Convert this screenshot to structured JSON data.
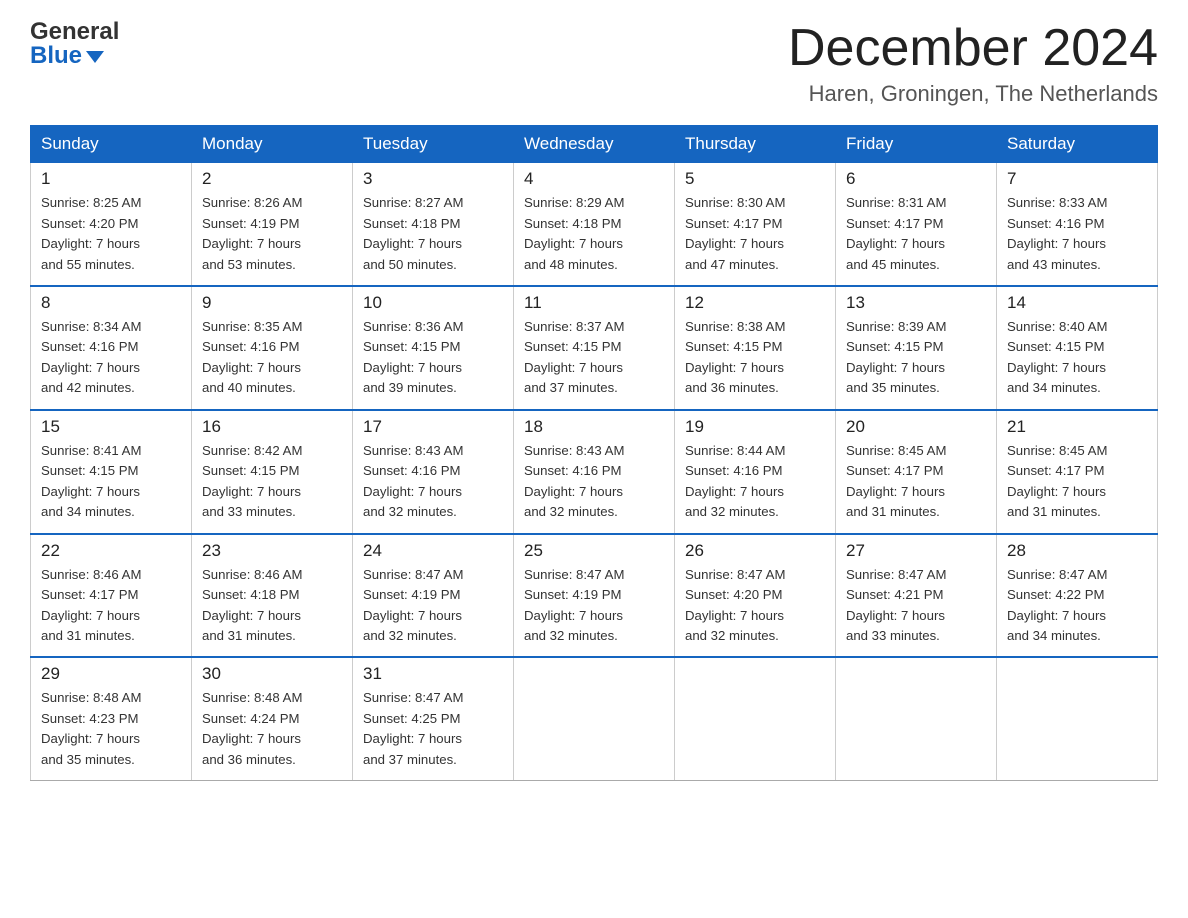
{
  "header": {
    "logo_general": "General",
    "logo_blue": "Blue",
    "main_title": "December 2024",
    "subtitle": "Haren, Groningen, The Netherlands"
  },
  "calendar": {
    "days": [
      "Sunday",
      "Monday",
      "Tuesday",
      "Wednesday",
      "Thursday",
      "Friday",
      "Saturday"
    ],
    "weeks": [
      [
        {
          "num": "1",
          "info": "Sunrise: 8:25 AM\nSunset: 4:20 PM\nDaylight: 7 hours\nand 55 minutes."
        },
        {
          "num": "2",
          "info": "Sunrise: 8:26 AM\nSunset: 4:19 PM\nDaylight: 7 hours\nand 53 minutes."
        },
        {
          "num": "3",
          "info": "Sunrise: 8:27 AM\nSunset: 4:18 PM\nDaylight: 7 hours\nand 50 minutes."
        },
        {
          "num": "4",
          "info": "Sunrise: 8:29 AM\nSunset: 4:18 PM\nDaylight: 7 hours\nand 48 minutes."
        },
        {
          "num": "5",
          "info": "Sunrise: 8:30 AM\nSunset: 4:17 PM\nDaylight: 7 hours\nand 47 minutes."
        },
        {
          "num": "6",
          "info": "Sunrise: 8:31 AM\nSunset: 4:17 PM\nDaylight: 7 hours\nand 45 minutes."
        },
        {
          "num": "7",
          "info": "Sunrise: 8:33 AM\nSunset: 4:16 PM\nDaylight: 7 hours\nand 43 minutes."
        }
      ],
      [
        {
          "num": "8",
          "info": "Sunrise: 8:34 AM\nSunset: 4:16 PM\nDaylight: 7 hours\nand 42 minutes."
        },
        {
          "num": "9",
          "info": "Sunrise: 8:35 AM\nSunset: 4:16 PM\nDaylight: 7 hours\nand 40 minutes."
        },
        {
          "num": "10",
          "info": "Sunrise: 8:36 AM\nSunset: 4:15 PM\nDaylight: 7 hours\nand 39 minutes."
        },
        {
          "num": "11",
          "info": "Sunrise: 8:37 AM\nSunset: 4:15 PM\nDaylight: 7 hours\nand 37 minutes."
        },
        {
          "num": "12",
          "info": "Sunrise: 8:38 AM\nSunset: 4:15 PM\nDaylight: 7 hours\nand 36 minutes."
        },
        {
          "num": "13",
          "info": "Sunrise: 8:39 AM\nSunset: 4:15 PM\nDaylight: 7 hours\nand 35 minutes."
        },
        {
          "num": "14",
          "info": "Sunrise: 8:40 AM\nSunset: 4:15 PM\nDaylight: 7 hours\nand 34 minutes."
        }
      ],
      [
        {
          "num": "15",
          "info": "Sunrise: 8:41 AM\nSunset: 4:15 PM\nDaylight: 7 hours\nand 34 minutes."
        },
        {
          "num": "16",
          "info": "Sunrise: 8:42 AM\nSunset: 4:15 PM\nDaylight: 7 hours\nand 33 minutes."
        },
        {
          "num": "17",
          "info": "Sunrise: 8:43 AM\nSunset: 4:16 PM\nDaylight: 7 hours\nand 32 minutes."
        },
        {
          "num": "18",
          "info": "Sunrise: 8:43 AM\nSunset: 4:16 PM\nDaylight: 7 hours\nand 32 minutes."
        },
        {
          "num": "19",
          "info": "Sunrise: 8:44 AM\nSunset: 4:16 PM\nDaylight: 7 hours\nand 32 minutes."
        },
        {
          "num": "20",
          "info": "Sunrise: 8:45 AM\nSunset: 4:17 PM\nDaylight: 7 hours\nand 31 minutes."
        },
        {
          "num": "21",
          "info": "Sunrise: 8:45 AM\nSunset: 4:17 PM\nDaylight: 7 hours\nand 31 minutes."
        }
      ],
      [
        {
          "num": "22",
          "info": "Sunrise: 8:46 AM\nSunset: 4:17 PM\nDaylight: 7 hours\nand 31 minutes."
        },
        {
          "num": "23",
          "info": "Sunrise: 8:46 AM\nSunset: 4:18 PM\nDaylight: 7 hours\nand 31 minutes."
        },
        {
          "num": "24",
          "info": "Sunrise: 8:47 AM\nSunset: 4:19 PM\nDaylight: 7 hours\nand 32 minutes."
        },
        {
          "num": "25",
          "info": "Sunrise: 8:47 AM\nSunset: 4:19 PM\nDaylight: 7 hours\nand 32 minutes."
        },
        {
          "num": "26",
          "info": "Sunrise: 8:47 AM\nSunset: 4:20 PM\nDaylight: 7 hours\nand 32 minutes."
        },
        {
          "num": "27",
          "info": "Sunrise: 8:47 AM\nSunset: 4:21 PM\nDaylight: 7 hours\nand 33 minutes."
        },
        {
          "num": "28",
          "info": "Sunrise: 8:47 AM\nSunset: 4:22 PM\nDaylight: 7 hours\nand 34 minutes."
        }
      ],
      [
        {
          "num": "29",
          "info": "Sunrise: 8:48 AM\nSunset: 4:23 PM\nDaylight: 7 hours\nand 35 minutes."
        },
        {
          "num": "30",
          "info": "Sunrise: 8:48 AM\nSunset: 4:24 PM\nDaylight: 7 hours\nand 36 minutes."
        },
        {
          "num": "31",
          "info": "Sunrise: 8:47 AM\nSunset: 4:25 PM\nDaylight: 7 hours\nand 37 minutes."
        },
        null,
        null,
        null,
        null
      ]
    ]
  }
}
